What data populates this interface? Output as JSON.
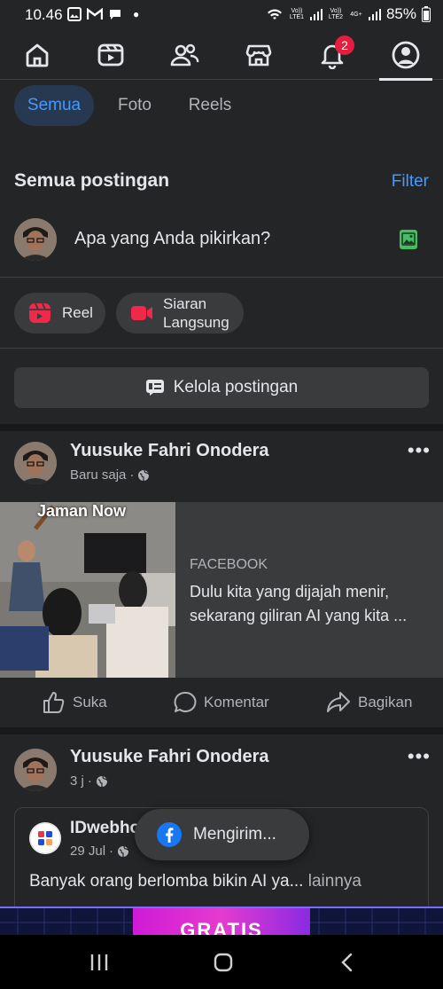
{
  "status_bar": {
    "time": "10.46",
    "sim1_label": "Vo)) LTE1",
    "sim2_label": "Vo)) LTE2",
    "network": "4G+",
    "battery": "85%"
  },
  "nav": {
    "notifications_badge": "2"
  },
  "filters": [
    "Semua",
    "Foto",
    "Reels"
  ],
  "section": {
    "title": "Semua postingan",
    "filter_label": "Filter"
  },
  "composer": {
    "placeholder": "Apa yang Anda pikirkan?"
  },
  "create_options": {
    "reel": "Reel",
    "live_line1": "Siaran",
    "live_line2": "Langsung"
  },
  "manage": {
    "label": "Kelola postingan"
  },
  "post1": {
    "author": "Yuusuke Fahri Onodera",
    "time": "Baru saja",
    "thumb_caption": "Jaman Now",
    "source": "FACEBOOK",
    "title": "Dulu kita yang dijajah menir, sekarang giliran AI yang kita ..."
  },
  "actions": {
    "like": "Suka",
    "comment": "Komentar",
    "share": "Bagikan"
  },
  "post2": {
    "author": "Yuusuke Fahri Onodera",
    "time": "3 j",
    "shared_page": "IDwebhost",
    "shared_time": "29 Jul",
    "shared_text": "Banyak orang berlomba bikin AI ya...",
    "more": "lainnya"
  },
  "toast": {
    "label": "Mengirim..."
  },
  "ad": {
    "text": "GRATIS"
  },
  "colors": {
    "background": "#242526",
    "accent": "#4599ff",
    "badge": "#e41e3f",
    "reel_icon": "#f02849",
    "live_icon": "#f02849",
    "photo_icon": "#45bd62"
  }
}
